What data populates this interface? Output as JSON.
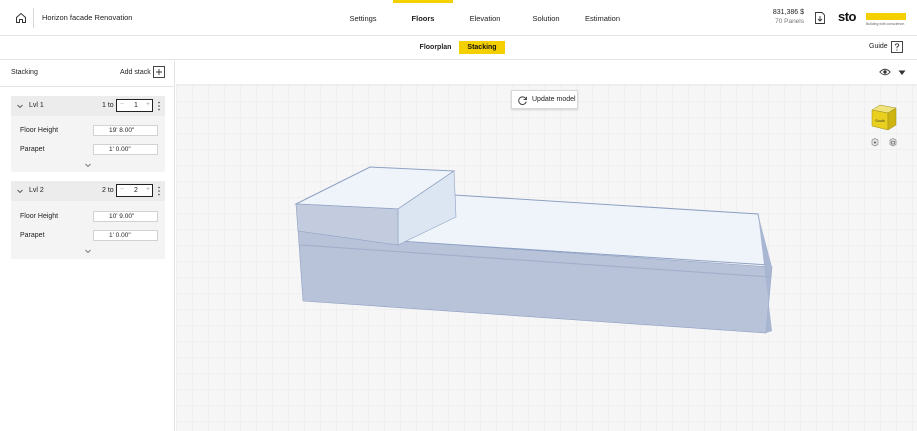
{
  "header": {
    "project_title": "Horizon facade Renovation",
    "tabs": [
      {
        "label": "Settings",
        "active": false
      },
      {
        "label": "Floors",
        "active": true
      },
      {
        "label": "Elevation",
        "active": false
      },
      {
        "label": "Solution",
        "active": false
      },
      {
        "label": "Estimation",
        "active": false
      }
    ],
    "cost": "831,386 $",
    "panels": "70 Panels",
    "logo_word": "sto",
    "logo_tagline": "Building with conscience."
  },
  "subheader": {
    "tabs": [
      {
        "label": "Floorplan",
        "active": false
      },
      {
        "label": "Stacking",
        "active": true
      }
    ],
    "guide_label": "Guide"
  },
  "left_panel": {
    "title": "Stacking",
    "add_stack_label": "Add stack",
    "stacks": [
      {
        "name": "Lvl 1",
        "to_label": "1 to",
        "count": "1",
        "fields": [
          {
            "label": "Floor Height",
            "value": "19' 8.00\""
          },
          {
            "label": "Parapet",
            "value": "1' 0.00\""
          }
        ]
      },
      {
        "name": "Lvl 2",
        "to_label": "2 to",
        "count": "2",
        "fields": [
          {
            "label": "Floor Height",
            "value": "10' 9.00\""
          },
          {
            "label": "Parapet",
            "value": "1' 0.00\""
          }
        ]
      }
    ]
  },
  "viewport": {
    "update_label": "Update model",
    "navcube_face": "South"
  },
  "colors": {
    "accent": "#f5d000",
    "building_side": "#b8c3da",
    "building_top": "#eef4fa",
    "building_edge": "#8ea0c2"
  }
}
